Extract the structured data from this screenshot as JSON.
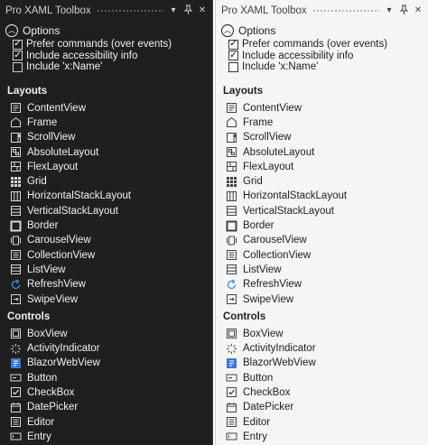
{
  "panel": {
    "title": "Pro XAML Toolbox",
    "options_label": "Options",
    "options": [
      {
        "label": "Prefer commands (over events)",
        "checked": true
      },
      {
        "label": "Include accessibility info",
        "checked": true
      },
      {
        "label": "Include 'x:Name'",
        "checked": false
      }
    ],
    "sections": {
      "layouts": "Layouts",
      "controls": "Controls"
    },
    "layouts": [
      {
        "label": "ContentView",
        "icon": "content-view-icon"
      },
      {
        "label": "Frame",
        "icon": "frame-icon"
      },
      {
        "label": "ScrollView",
        "icon": "scroll-view-icon"
      },
      {
        "label": "AbsoluteLayout",
        "icon": "absolute-layout-icon"
      },
      {
        "label": "FlexLayout",
        "icon": "flex-layout-icon"
      },
      {
        "label": "Grid",
        "icon": "grid-icon"
      },
      {
        "label": "HorizontalStackLayout",
        "icon": "horizontal-stack-icon"
      },
      {
        "label": "VerticalStackLayout",
        "icon": "vertical-stack-icon"
      },
      {
        "label": "Border",
        "icon": "border-icon"
      },
      {
        "label": "CarouselView",
        "icon": "carousel-icon"
      },
      {
        "label": "CollectionView",
        "icon": "collection-view-icon"
      },
      {
        "label": "ListView",
        "icon": "list-view-icon"
      },
      {
        "label": "RefreshView",
        "icon": "refresh-icon"
      },
      {
        "label": "SwipeView",
        "icon": "swipe-icon"
      }
    ],
    "controls": [
      {
        "label": "BoxView",
        "icon": "box-view-icon"
      },
      {
        "label": "ActivityIndicator",
        "icon": "activity-indicator-icon"
      },
      {
        "label": "BlazorWebView",
        "icon": "blazor-webview-icon"
      },
      {
        "label": "Button",
        "icon": "button-icon"
      },
      {
        "label": "CheckBox",
        "icon": "checkbox-icon"
      },
      {
        "label": "DatePicker",
        "icon": "date-picker-icon"
      },
      {
        "label": "Editor",
        "icon": "editor-icon"
      },
      {
        "label": "Entry",
        "icon": "entry-icon"
      }
    ]
  }
}
